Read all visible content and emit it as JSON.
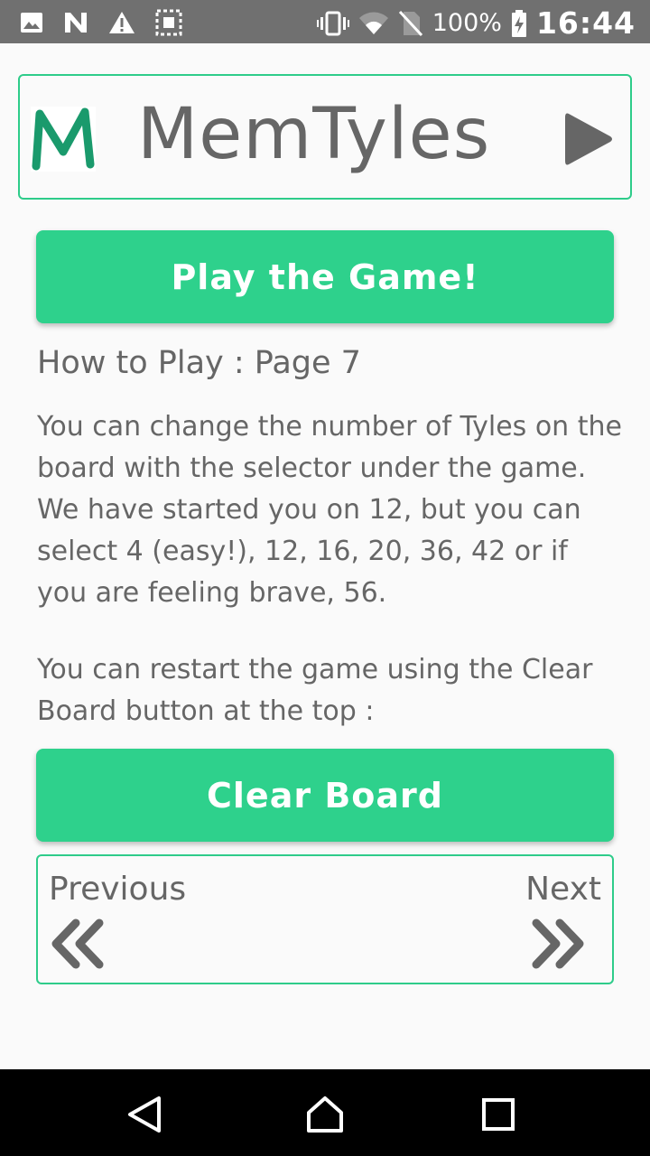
{
  "status_bar": {
    "battery_percent": "100%",
    "time": "16:44",
    "icons": [
      "image-icon",
      "n-icon",
      "warning-icon",
      "screenshot-icon",
      "vibrate-icon",
      "wifi-icon",
      "no-sim-icon",
      "battery-charging-icon"
    ]
  },
  "header": {
    "logo_letter": "M",
    "title": "MemTyles",
    "play_icon": "play-icon"
  },
  "play_button": {
    "label": "Play the Game!"
  },
  "how_to": {
    "title": "How to Play : Page 7",
    "paragraph1": "You can change the number of Tyles on the board with the selector under the game.  We have started you on 12, but you can select 4 (easy!), 12, 16, 20, 36, 42 or if you are feeling brave, 56.",
    "paragraph2": "You can restart the game using the Clear Board button at the top :"
  },
  "clear_button": {
    "label": "Clear Board"
  },
  "pager": {
    "previous_label": "Previous",
    "next_label": "Next"
  },
  "colors": {
    "accent": "#2ed18c",
    "status_bar": "#707070",
    "text": "#666666",
    "logo": "#1a9a6c"
  }
}
